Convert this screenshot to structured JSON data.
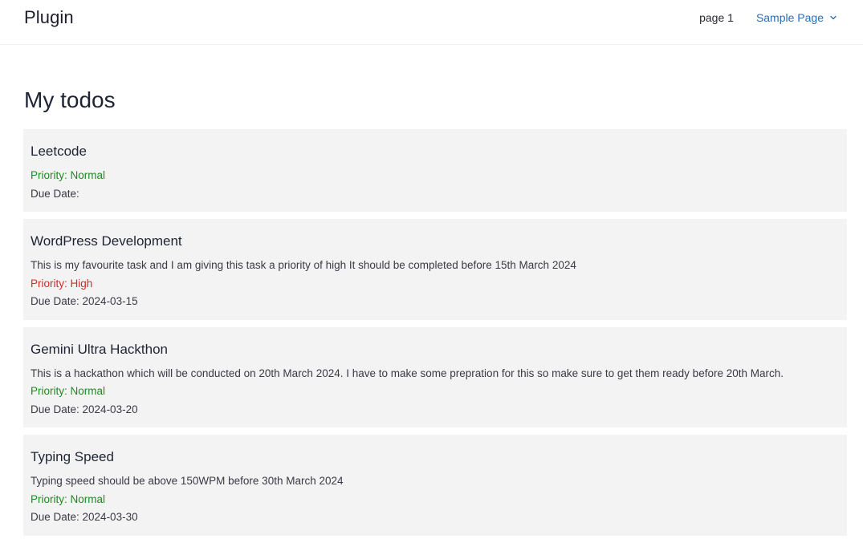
{
  "header": {
    "site_title": "Plugin",
    "nav": [
      {
        "label": "page 1"
      },
      {
        "label": "Sample Page",
        "icon": "chevron-down-icon"
      }
    ]
  },
  "main": {
    "title": "My todos",
    "todos": [
      {
        "title": "Leetcode",
        "description": "",
        "priority": "Priority: Normal",
        "priority_level": "normal",
        "due": "Due Date:"
      },
      {
        "title": "WordPress Development",
        "description": "This is my favourite task and I am giving this task a priority of high It should be completed before 15th March 2024",
        "priority": "Priority: High",
        "priority_level": "high",
        "due": "Due Date: 2024-03-15"
      },
      {
        "title": "Gemini Ultra Hackthon",
        "description": "This is a hackathon which will be conducted on 20th March 2024. I have to make some prepration for this so make sure to get them ready before 20th March.",
        "priority": "Priority: Normal",
        "priority_level": "normal",
        "due": "Due Date: 2024-03-20"
      },
      {
        "title": "Typing Speed",
        "description": "Typing speed should be above 150WPM before 30th March 2024",
        "priority": "Priority: Normal",
        "priority_level": "normal",
        "due": "Due Date: 2024-03-30"
      }
    ]
  },
  "colors": {
    "priority_normal": "#1f8a1f",
    "priority_high": "#d42a2a",
    "link": "#2a6db8",
    "card_bg": "#f3f3f3"
  }
}
